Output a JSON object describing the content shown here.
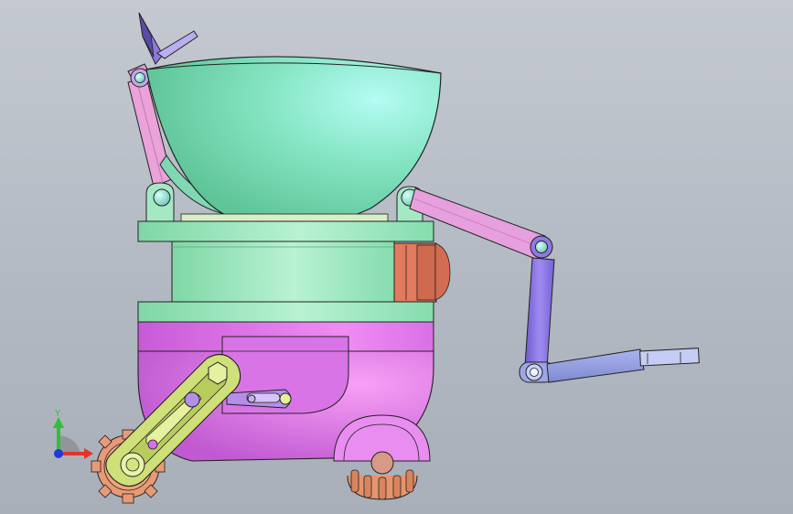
{
  "viewport": {
    "background_top": "#c4c9d1",
    "background_bottom": "#a9afb9"
  },
  "triad": {
    "y_label": "Y",
    "y_color": "#2fbf3a",
    "x_color": "#e0362a",
    "z_color": "#1f3ad6"
  },
  "colors": {
    "bowl": "#7fe0b8",
    "bowl_highlight": "#a8f4ea",
    "body_green": "#9ce8bd",
    "body_magenta": "#d96ee8",
    "magenta_light": "#f08af2",
    "arm_pink": "#e59ad2",
    "arm_violet": "#8f78e6",
    "arm_blue": "#8f9ce0",
    "panel_orange": "#e27a5e",
    "link_yellow": "#cfe07a",
    "wheel_gear": "#e89a76",
    "joint_teal": "#9fe6dc"
  }
}
